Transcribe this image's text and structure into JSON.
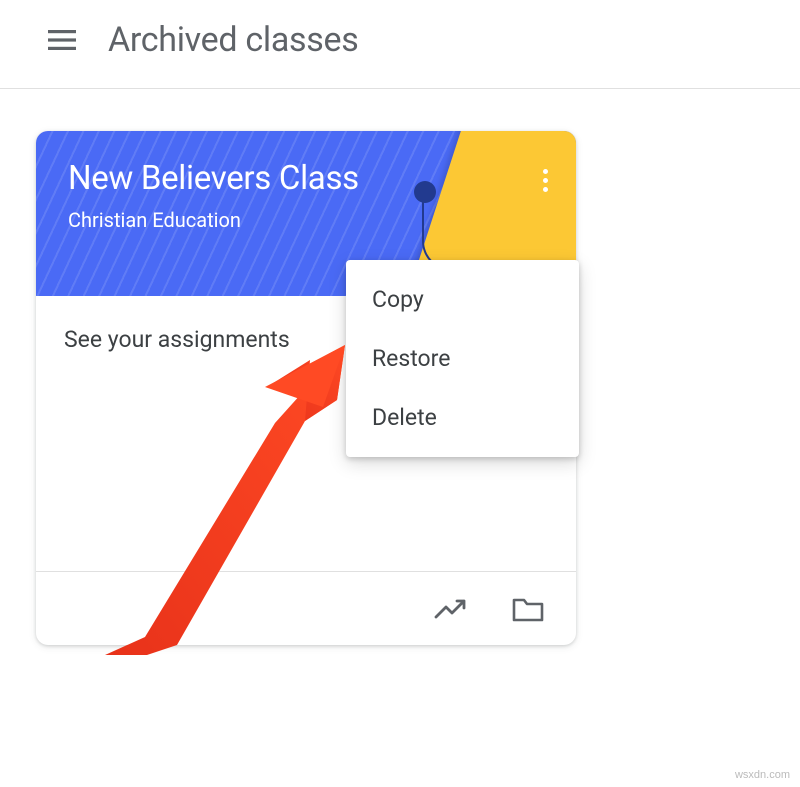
{
  "header": {
    "title": "Archived classes"
  },
  "class_card": {
    "title": "New Believers Class",
    "section": "Christian Education",
    "assignments_link": "See your assignments"
  },
  "menu": {
    "items": [
      {
        "label": "Copy"
      },
      {
        "label": "Restore"
      },
      {
        "label": "Delete"
      }
    ]
  },
  "watermark": "wsxdn.com"
}
